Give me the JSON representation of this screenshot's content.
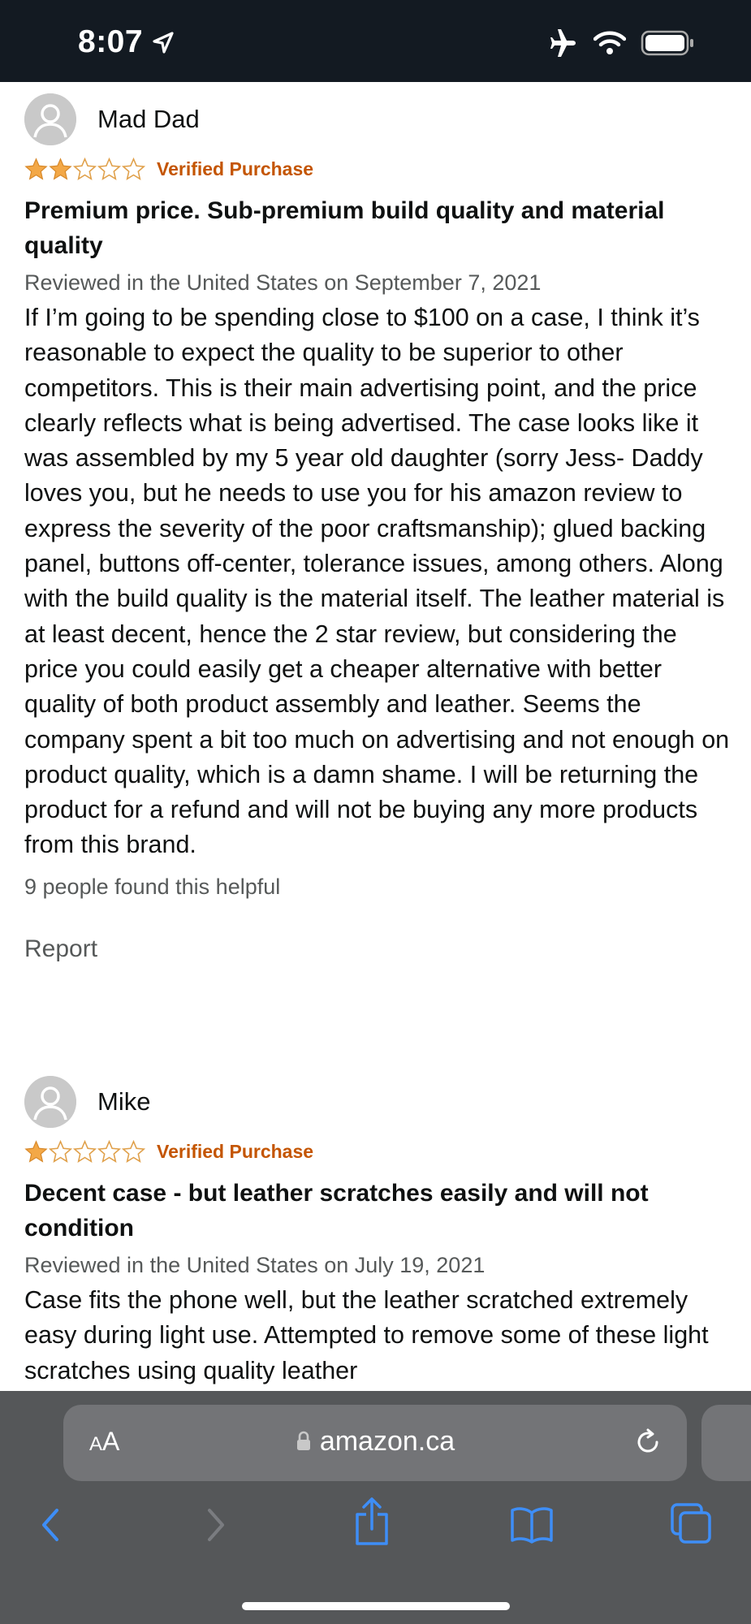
{
  "status_bar": {
    "time": "8:07",
    "icons": [
      "location-arrow-icon",
      "airplane-icon",
      "wifi-icon",
      "battery-icon"
    ]
  },
  "reviews": [
    {
      "username": "Mad Dad",
      "rating": 2,
      "max_rating": 5,
      "verified": "Verified Purchase",
      "title": "Premium price. Sub-premium build quality and material quality",
      "date": "Reviewed in the United States on September 7, 2021",
      "body": "If I’m going to be spending close to $100 on a case, I think it’s reasonable to expect the quality to be superior to other competitors. This is their main advertising point, and the price clearly reflects what is being advertised. The case looks like it was assembled by my 5 year old daughter (sorry Jess- Daddy loves you, but he needs to use you for his amazon review to express the severity of the poor craftsmanship); glued backing panel, buttons off-center, tolerance issues, among others. Along with the build quality is the material itself. The leather material is at least decent, hence the 2 star review, but considering the price you could easily get a cheaper alternative with better quality of both product assembly and leather. Seems the company spent a bit too much on advertising and not enough on product quality, which is a damn shame. I will be returning the product for a refund and will not be buying any more products from this brand.",
      "helpful": "9 people found this helpful",
      "report": "Report"
    },
    {
      "username": "Mike",
      "rating": 1,
      "max_rating": 5,
      "verified": "Verified Purchase",
      "title": "Decent case - but leather scratches easily and will not condition",
      "date": "Reviewed in the United States on July 19, 2021",
      "body": "Case fits the phone well, but the leather scratched extremely easy during light use. Attempted to remove some of these light scratches using quality leather"
    }
  ],
  "browser": {
    "text_size_label_big": "A",
    "text_size_label_small": "A",
    "url": "amazon.ca",
    "toolbar_icons": [
      "back-icon",
      "forward-icon",
      "share-icon",
      "bookmarks-icon",
      "tabs-icon"
    ]
  },
  "colors": {
    "status_bar_bg": "#131a22",
    "star": "#f3a847",
    "verified": "#c45500",
    "secondary_text": "#565959",
    "toolbar_bg": "#555759",
    "url_field_bg": "#737477",
    "toolbar_icon_blue": "#3e8ef7"
  }
}
